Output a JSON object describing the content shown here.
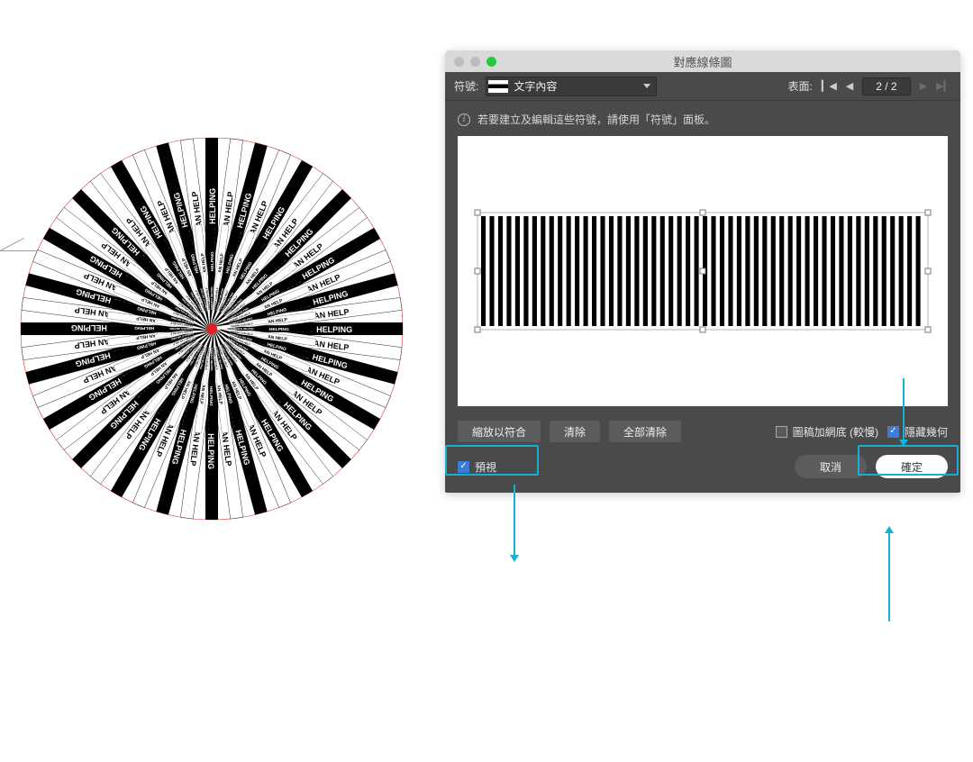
{
  "artwork": {
    "repeat_text": "TAIWAN IS HELPING",
    "secondary_text": "TAIWAN CAN HELP"
  },
  "dialog": {
    "title": "對應線條圖",
    "symbol_label": "符號:",
    "symbol_value": "文字內容",
    "surface_label": "表面:",
    "page_display": "2 / 2",
    "info_text": "若要建立及編輯這些符號，請使用「符號」面板。",
    "buttons": {
      "fit": "縮放以符合",
      "clear": "清除",
      "clear_all": "全部清除"
    },
    "checkboxes": {
      "shade_label": "圖稿加網底 (較慢)",
      "shade_checked": false,
      "hide_geom_label": "隱藏幾何",
      "hide_geom_checked": true,
      "preview_label": "預視",
      "preview_checked": true
    },
    "footer": {
      "cancel": "取消",
      "ok": "確定"
    }
  }
}
